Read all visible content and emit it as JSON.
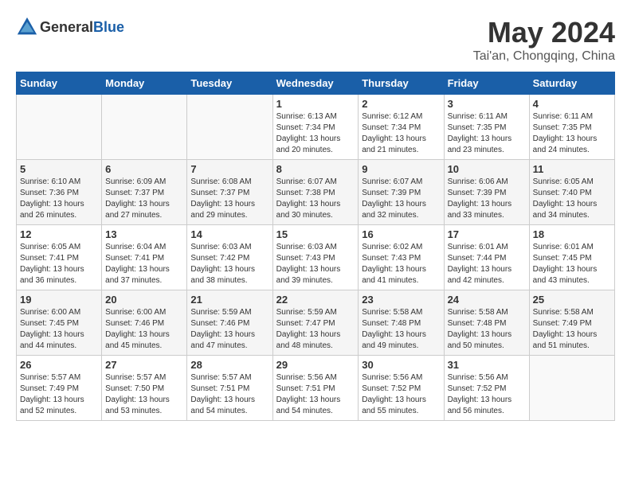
{
  "header": {
    "logo_general": "General",
    "logo_blue": "Blue",
    "month": "May 2024",
    "location": "Tai'an, Chongqing, China"
  },
  "weekdays": [
    "Sunday",
    "Monday",
    "Tuesday",
    "Wednesday",
    "Thursday",
    "Friday",
    "Saturday"
  ],
  "weeks": [
    [
      {
        "day": "",
        "info": ""
      },
      {
        "day": "",
        "info": ""
      },
      {
        "day": "",
        "info": ""
      },
      {
        "day": "1",
        "info": "Sunrise: 6:13 AM\nSunset: 7:34 PM\nDaylight: 13 hours and 20 minutes."
      },
      {
        "day": "2",
        "info": "Sunrise: 6:12 AM\nSunset: 7:34 PM\nDaylight: 13 hours and 21 minutes."
      },
      {
        "day": "3",
        "info": "Sunrise: 6:11 AM\nSunset: 7:35 PM\nDaylight: 13 hours and 23 minutes."
      },
      {
        "day": "4",
        "info": "Sunrise: 6:11 AM\nSunset: 7:35 PM\nDaylight: 13 hours and 24 minutes."
      }
    ],
    [
      {
        "day": "5",
        "info": "Sunrise: 6:10 AM\nSunset: 7:36 PM\nDaylight: 13 hours and 26 minutes."
      },
      {
        "day": "6",
        "info": "Sunrise: 6:09 AM\nSunset: 7:37 PM\nDaylight: 13 hours and 27 minutes."
      },
      {
        "day": "7",
        "info": "Sunrise: 6:08 AM\nSunset: 7:37 PM\nDaylight: 13 hours and 29 minutes."
      },
      {
        "day": "8",
        "info": "Sunrise: 6:07 AM\nSunset: 7:38 PM\nDaylight: 13 hours and 30 minutes."
      },
      {
        "day": "9",
        "info": "Sunrise: 6:07 AM\nSunset: 7:39 PM\nDaylight: 13 hours and 32 minutes."
      },
      {
        "day": "10",
        "info": "Sunrise: 6:06 AM\nSunset: 7:39 PM\nDaylight: 13 hours and 33 minutes."
      },
      {
        "day": "11",
        "info": "Sunrise: 6:05 AM\nSunset: 7:40 PM\nDaylight: 13 hours and 34 minutes."
      }
    ],
    [
      {
        "day": "12",
        "info": "Sunrise: 6:05 AM\nSunset: 7:41 PM\nDaylight: 13 hours and 36 minutes."
      },
      {
        "day": "13",
        "info": "Sunrise: 6:04 AM\nSunset: 7:41 PM\nDaylight: 13 hours and 37 minutes."
      },
      {
        "day": "14",
        "info": "Sunrise: 6:03 AM\nSunset: 7:42 PM\nDaylight: 13 hours and 38 minutes."
      },
      {
        "day": "15",
        "info": "Sunrise: 6:03 AM\nSunset: 7:43 PM\nDaylight: 13 hours and 39 minutes."
      },
      {
        "day": "16",
        "info": "Sunrise: 6:02 AM\nSunset: 7:43 PM\nDaylight: 13 hours and 41 minutes."
      },
      {
        "day": "17",
        "info": "Sunrise: 6:01 AM\nSunset: 7:44 PM\nDaylight: 13 hours and 42 minutes."
      },
      {
        "day": "18",
        "info": "Sunrise: 6:01 AM\nSunset: 7:45 PM\nDaylight: 13 hours and 43 minutes."
      }
    ],
    [
      {
        "day": "19",
        "info": "Sunrise: 6:00 AM\nSunset: 7:45 PM\nDaylight: 13 hours and 44 minutes."
      },
      {
        "day": "20",
        "info": "Sunrise: 6:00 AM\nSunset: 7:46 PM\nDaylight: 13 hours and 45 minutes."
      },
      {
        "day": "21",
        "info": "Sunrise: 5:59 AM\nSunset: 7:46 PM\nDaylight: 13 hours and 47 minutes."
      },
      {
        "day": "22",
        "info": "Sunrise: 5:59 AM\nSunset: 7:47 PM\nDaylight: 13 hours and 48 minutes."
      },
      {
        "day": "23",
        "info": "Sunrise: 5:58 AM\nSunset: 7:48 PM\nDaylight: 13 hours and 49 minutes."
      },
      {
        "day": "24",
        "info": "Sunrise: 5:58 AM\nSunset: 7:48 PM\nDaylight: 13 hours and 50 minutes."
      },
      {
        "day": "25",
        "info": "Sunrise: 5:58 AM\nSunset: 7:49 PM\nDaylight: 13 hours and 51 minutes."
      }
    ],
    [
      {
        "day": "26",
        "info": "Sunrise: 5:57 AM\nSunset: 7:49 PM\nDaylight: 13 hours and 52 minutes."
      },
      {
        "day": "27",
        "info": "Sunrise: 5:57 AM\nSunset: 7:50 PM\nDaylight: 13 hours and 53 minutes."
      },
      {
        "day": "28",
        "info": "Sunrise: 5:57 AM\nSunset: 7:51 PM\nDaylight: 13 hours and 54 minutes."
      },
      {
        "day": "29",
        "info": "Sunrise: 5:56 AM\nSunset: 7:51 PM\nDaylight: 13 hours and 54 minutes."
      },
      {
        "day": "30",
        "info": "Sunrise: 5:56 AM\nSunset: 7:52 PM\nDaylight: 13 hours and 55 minutes."
      },
      {
        "day": "31",
        "info": "Sunrise: 5:56 AM\nSunset: 7:52 PM\nDaylight: 13 hours and 56 minutes."
      },
      {
        "day": "",
        "info": ""
      }
    ]
  ]
}
